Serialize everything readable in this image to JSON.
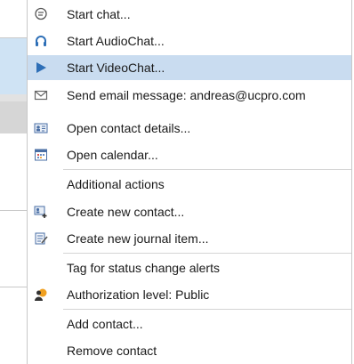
{
  "menu": {
    "items": [
      {
        "label": "Start chat...",
        "icon": "chat-bubble-icon"
      },
      {
        "label": "Start AudioChat...",
        "icon": "headset-icon"
      },
      {
        "label": "Start VideoChat...",
        "icon": "play-icon"
      },
      {
        "label": "Send email message: andreas@ucpro.com",
        "icon": "envelope-icon"
      },
      {
        "label": "Open contact details...",
        "icon": "contact-card-icon"
      },
      {
        "label": "Open calendar...",
        "icon": "calendar-icon"
      },
      {
        "label": "Additional actions",
        "icon": ""
      },
      {
        "label": "Create new contact...",
        "icon": "add-contact-icon"
      },
      {
        "label": "Create new journal item...",
        "icon": "journal-icon"
      },
      {
        "label": "Tag for status change alerts",
        "icon": ""
      },
      {
        "label": "Authorization level: Public",
        "icon": "authorization-icon"
      },
      {
        "label": "Add contact...",
        "icon": ""
      },
      {
        "label": "Remove contact",
        "icon": ""
      }
    ]
  },
  "colors": {
    "highlight": "#c9dcf0",
    "accent_blue": "#2e6fb7"
  }
}
